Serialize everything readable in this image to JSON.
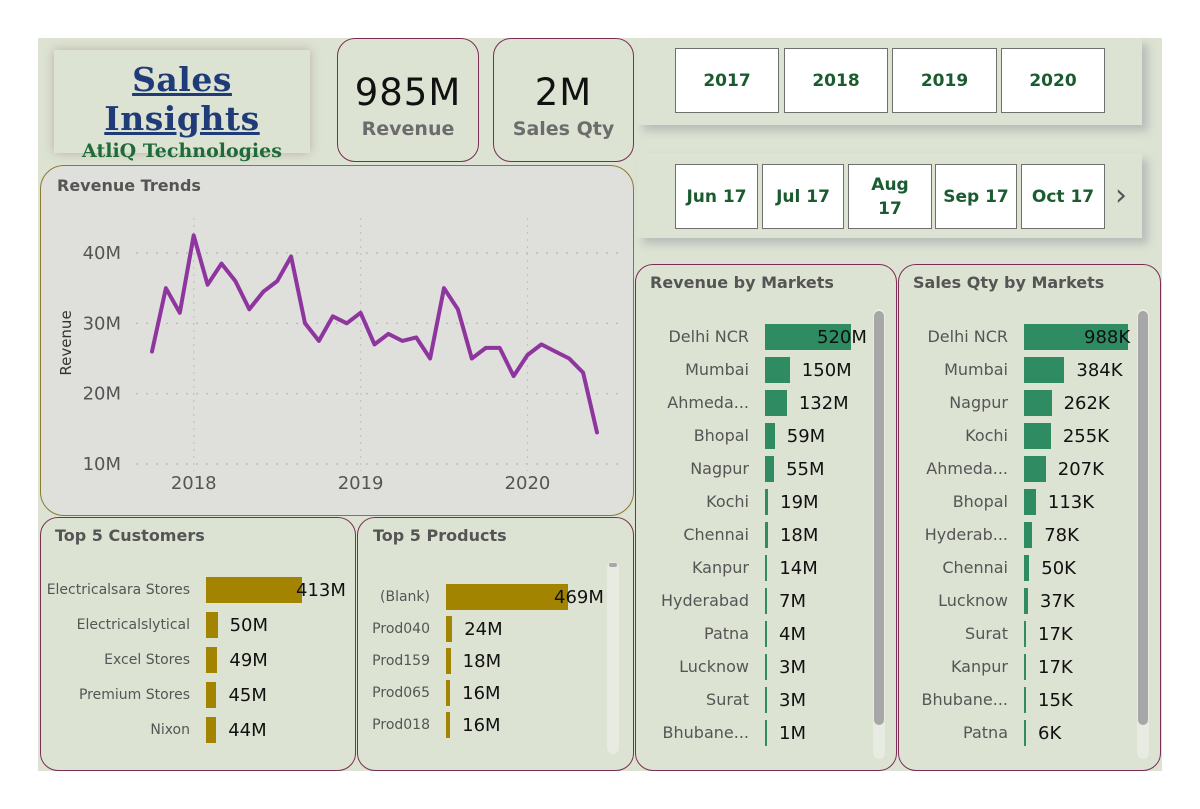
{
  "header": {
    "title": "Sales Insights",
    "subtitle": "AtliQ Technologies"
  },
  "kpis": {
    "revenue": {
      "value": "985M",
      "label": "Revenue"
    },
    "sales_qty": {
      "value": "2M",
      "label": "Sales Qty"
    }
  },
  "year_slicer": [
    "2017",
    "2018",
    "2019",
    "2020"
  ],
  "month_slicer": {
    "items": [
      "Jun 17",
      "Jul 17",
      "Aug 17",
      "Sep 17",
      "Oct 17"
    ],
    "next_icon": "chevron-right-icon"
  },
  "revenue_trends": {
    "title": "Revenue Trends",
    "ylabel": "Revenue",
    "y_ticks": [
      "40M",
      "30M",
      "20M",
      "10M"
    ],
    "x_ticks": [
      "2018",
      "2019",
      "2020"
    ],
    "line_color": "#8e35a0"
  },
  "top_customers": {
    "title": "Top 5 Customers",
    "bar_color": "#a28400",
    "rows": [
      {
        "label": "Electricalsara Stores",
        "value": 413,
        "text": "413M"
      },
      {
        "label": "Electricalslytical",
        "value": 50,
        "text": "50M"
      },
      {
        "label": "Excel Stores",
        "value": 49,
        "text": "49M"
      },
      {
        "label": "Premium Stores",
        "value": 45,
        "text": "45M"
      },
      {
        "label": "Nixon",
        "value": 44,
        "text": "44M"
      }
    ]
  },
  "top_products": {
    "title": "Top 5 Products",
    "bar_color": "#a28400",
    "rows": [
      {
        "label": "(Blank)",
        "value": 469,
        "text": "469M"
      },
      {
        "label": "Prod040",
        "value": 24,
        "text": "24M"
      },
      {
        "label": "Prod159",
        "value": 18,
        "text": "18M"
      },
      {
        "label": "Prod065",
        "value": 16,
        "text": "16M"
      },
      {
        "label": "Prod018",
        "value": 16,
        "text": "16M"
      }
    ]
  },
  "revenue_by_markets": {
    "title": "Revenue by Markets",
    "bar_color": "#2e8b62",
    "rows": [
      {
        "label": "Delhi NCR",
        "value": 520,
        "text": "520M"
      },
      {
        "label": "Mumbai",
        "value": 150,
        "text": "150M"
      },
      {
        "label": "Ahmeda...",
        "value": 132,
        "text": "132M"
      },
      {
        "label": "Bhopal",
        "value": 59,
        "text": "59M"
      },
      {
        "label": "Nagpur",
        "value": 55,
        "text": "55M"
      },
      {
        "label": "Kochi",
        "value": 19,
        "text": "19M"
      },
      {
        "label": "Chennai",
        "value": 18,
        "text": "18M"
      },
      {
        "label": "Kanpur",
        "value": 14,
        "text": "14M"
      },
      {
        "label": "Hyderabad",
        "value": 7,
        "text": "7M"
      },
      {
        "label": "Patna",
        "value": 4,
        "text": "4M"
      },
      {
        "label": "Lucknow",
        "value": 3,
        "text": "3M"
      },
      {
        "label": "Surat",
        "value": 3,
        "text": "3M"
      },
      {
        "label": "Bhubane...",
        "value": 1,
        "text": "1M"
      }
    ]
  },
  "sales_qty_by_markets": {
    "title": "Sales Qty by Markets",
    "bar_color": "#2e8b62",
    "rows": [
      {
        "label": "Delhi NCR",
        "value": 988,
        "text": "988K"
      },
      {
        "label": "Mumbai",
        "value": 384,
        "text": "384K"
      },
      {
        "label": "Nagpur",
        "value": 262,
        "text": "262K"
      },
      {
        "label": "Kochi",
        "value": 255,
        "text": "255K"
      },
      {
        "label": "Ahmeda...",
        "value": 207,
        "text": "207K"
      },
      {
        "label": "Bhopal",
        "value": 113,
        "text": "113K"
      },
      {
        "label": "Hyderab...",
        "value": 78,
        "text": "78K"
      },
      {
        "label": "Chennai",
        "value": 50,
        "text": "50K"
      },
      {
        "label": "Lucknow",
        "value": 37,
        "text": "37K"
      },
      {
        "label": "Surat",
        "value": 17,
        "text": "17K"
      },
      {
        "label": "Kanpur",
        "value": 17,
        "text": "17K"
      },
      {
        "label": "Bhubane...",
        "value": 15,
        "text": "15K"
      },
      {
        "label": "Patna",
        "value": 6,
        "text": "6K"
      }
    ]
  },
  "chart_data": [
    {
      "type": "line",
      "title": "Revenue Trends",
      "xlabel": "",
      "ylabel": "Revenue",
      "ylim": [
        8,
        44
      ],
      "x": [
        "2017-10",
        "2017-11",
        "2017-12",
        "2018-01",
        "2018-02",
        "2018-03",
        "2018-04",
        "2018-05",
        "2018-06",
        "2018-07",
        "2018-08",
        "2018-09",
        "2018-10",
        "2018-11",
        "2018-12",
        "2019-01",
        "2019-02",
        "2019-03",
        "2019-04",
        "2019-05",
        "2019-06",
        "2019-07",
        "2019-08",
        "2019-09",
        "2019-10",
        "2019-11",
        "2019-12",
        "2020-01",
        "2020-02",
        "2020-03",
        "2020-04",
        "2020-05",
        "2020-06"
      ],
      "series": [
        {
          "values": [
            26,
            35,
            31.5,
            42.5,
            35.5,
            38.5,
            36,
            32,
            34.5,
            36,
            39.5,
            30,
            27.5,
            31,
            30,
            31.5,
            27,
            28.5,
            27.5,
            28,
            25,
            35,
            32,
            25,
            26.5,
            26.5,
            22.5,
            25.5,
            27,
            26,
            25,
            23,
            14.5
          ]
        }
      ]
    },
    {
      "type": "bar",
      "title": "Top 5 Customers",
      "categories": [
        "Electricalsara Stores",
        "Electricalslytical",
        "Excel Stores",
        "Premium Stores",
        "Nixon"
      ],
      "values": [
        413,
        50,
        49,
        45,
        44
      ]
    },
    {
      "type": "bar",
      "title": "Top 5 Products",
      "categories": [
        "(Blank)",
        "Prod040",
        "Prod159",
        "Prod065",
        "Prod018"
      ],
      "values": [
        469,
        24,
        18,
        16,
        16
      ]
    },
    {
      "type": "bar",
      "title": "Revenue by Markets",
      "categories": [
        "Delhi NCR",
        "Mumbai",
        "Ahmeda...",
        "Bhopal",
        "Nagpur",
        "Kochi",
        "Chennai",
        "Kanpur",
        "Hyderabad",
        "Patna",
        "Lucknow",
        "Surat",
        "Bhubane..."
      ],
      "values": [
        520,
        150,
        132,
        59,
        55,
        19,
        18,
        14,
        7,
        4,
        3,
        3,
        1
      ]
    },
    {
      "type": "bar",
      "title": "Sales Qty by Markets",
      "categories": [
        "Delhi NCR",
        "Mumbai",
        "Nagpur",
        "Kochi",
        "Ahmeda...",
        "Bhopal",
        "Hyderab...",
        "Chennai",
        "Lucknow",
        "Surat",
        "Kanpur",
        "Bhubane...",
        "Patna"
      ],
      "values": [
        988,
        384,
        262,
        255,
        207,
        113,
        78,
        50,
        37,
        17,
        17,
        15,
        6
      ]
    }
  ]
}
